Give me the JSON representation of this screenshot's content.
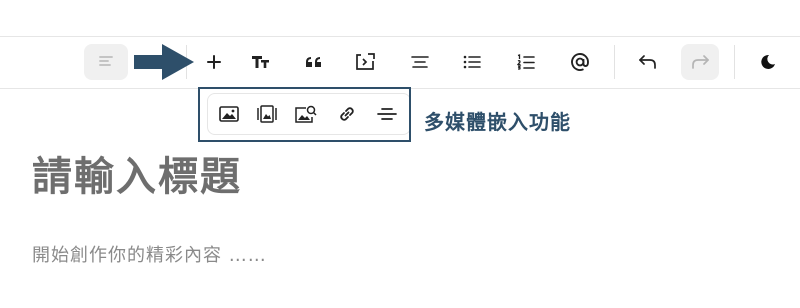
{
  "toolbar": {
    "buttons": [
      {
        "name": "align-left-button",
        "icon": "align-left-icon",
        "disabled": true
      },
      {
        "name": "add-button",
        "icon": "plus-icon",
        "label": "+"
      },
      {
        "name": "text-size-button",
        "icon": "text-size-icon",
        "label": "TT"
      },
      {
        "name": "quote-button",
        "icon": "quote-icon",
        "label": "❝"
      },
      {
        "name": "code-block-button",
        "icon": "code-block-icon"
      },
      {
        "name": "align-center-button",
        "icon": "align-center-icon"
      },
      {
        "name": "bullet-list-button",
        "icon": "bullet-list-icon"
      },
      {
        "name": "numbered-list-button",
        "icon": "numbered-list-icon"
      },
      {
        "name": "mention-button",
        "icon": "at-icon",
        "label": "@"
      },
      {
        "name": "undo-button",
        "icon": "undo-icon"
      },
      {
        "name": "redo-button",
        "icon": "redo-icon",
        "disabled": true
      },
      {
        "name": "dark-mode-button",
        "icon": "moon-icon"
      }
    ]
  },
  "media_popup": {
    "items": [
      {
        "name": "insert-image-button",
        "icon": "image-icon"
      },
      {
        "name": "insert-gallery-button",
        "icon": "gallery-icon"
      },
      {
        "name": "search-image-button",
        "icon": "image-search-icon"
      },
      {
        "name": "insert-link-button",
        "icon": "link-icon"
      },
      {
        "name": "insert-divider-button",
        "icon": "divider-icon"
      }
    ]
  },
  "callout": {
    "text": "多媒體嵌入功能"
  },
  "editor": {
    "title_placeholder": "請輸入標題",
    "body_placeholder": "開始創作你的精彩內容 ……"
  },
  "colors": {
    "accent": "#2e4f6a",
    "disabled": "#bfbfbf"
  }
}
